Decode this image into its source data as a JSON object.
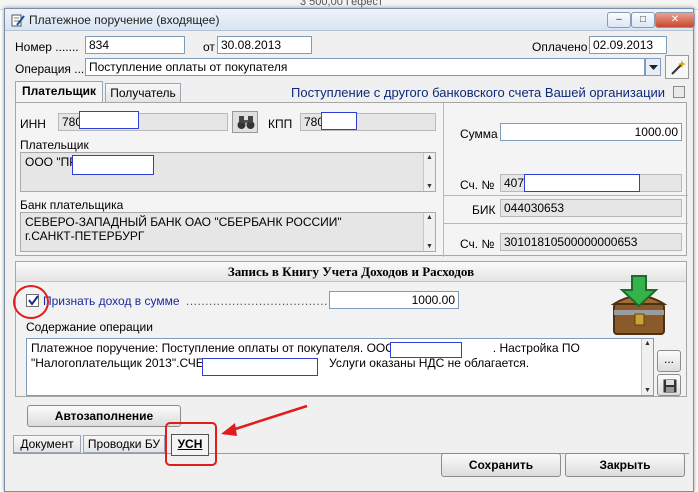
{
  "background": {
    "snippet": "3 500,00 Гефест"
  },
  "window": {
    "title": "Платежное поручение (входящее)",
    "minimize_glyph": "–",
    "maximize_glyph": "□",
    "close_glyph": "✕"
  },
  "header": {
    "number_label": "Номер .......",
    "number_value": "834",
    "date_label": "от",
    "date_value": "30.08.2013",
    "paid_label": "Оплачено",
    "paid_value": "02.09.2013",
    "operation_label": "Операция ...",
    "operation_value": "Поступление оплаты от покупателя"
  },
  "tabs": {
    "payer": "Плательщик",
    "recipient": "Получатель",
    "other_account_label": "Поступление с другого банковского счета Вашей организации"
  },
  "payer": {
    "inn_label": "ИНН",
    "inn_value": "780",
    "kpp_label": "КПП",
    "kpp_value": "780",
    "payer_label": "Плательщик",
    "payer_value": "ООО \"ПР",
    "bank_label": "Банк плательщика",
    "bank_line1": "СЕВЕРО-ЗАПАДНЫЙ БАНК ОАО \"СБЕРБАНК РОССИИ\"",
    "bank_line2": "г.САНКТ-ПЕТЕРБУРГ",
    "sum_label": "Сумма",
    "sum_value": "1000.00",
    "account_label": "Сч. №",
    "account_value": "4070",
    "bik_label": "БИК",
    "bik_value": "044030653",
    "corr_label": "Сч. №",
    "corr_value": "30101810500000000653"
  },
  "book": {
    "title": "Запись в Книгу Учета Доходов и Расходов",
    "recognize_label": "Признать доход в сумме",
    "recognize_dots": "..............................................",
    "recognize_value": "1000.00",
    "content_label": "Содержание операции",
    "content_line1a": "Платежное поручение: Поступление оплаты от покупателя. ООО \"ПР",
    "content_line1b": ". Настройка ПО",
    "content_line2a": "\"Налогоплательщик 2013\".СЧЕТ",
    "content_line2b": "Услуги оказаны НДС не облагается.",
    "dots_button": "...",
    "autofill_button": "Автозаполнение"
  },
  "bottom_tabs": {
    "document": "Документ",
    "postings": "Проводки БУ",
    "usn": "УСН"
  },
  "actions": {
    "save": "Сохранить",
    "close": "Закрыть"
  }
}
